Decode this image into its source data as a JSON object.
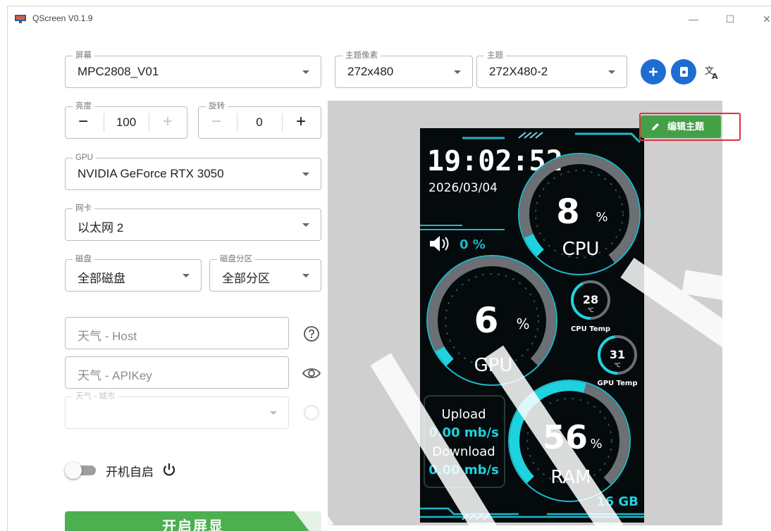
{
  "window": {
    "title": "QScreen V0.1.9",
    "controls": {
      "minimize": "—",
      "maximize": "☐",
      "close": "✕"
    }
  },
  "screen": {
    "legend": "屏幕",
    "value": "MPC2808_V01"
  },
  "theme_pixels": {
    "legend": "主题像素",
    "value": "272x480"
  },
  "theme": {
    "legend": "主题",
    "value": "272X480-2"
  },
  "actions": {
    "add_icon": "plus-icon",
    "import_icon": "document-icon",
    "translate_icon": "translate-icon"
  },
  "brightness": {
    "legend": "亮度",
    "value": "100",
    "minus": "−",
    "plus": "+"
  },
  "rotation": {
    "legend": "旋转",
    "value": "0",
    "minus": "−",
    "plus": "+"
  },
  "gpu": {
    "legend": "GPU",
    "value": "NVIDIA GeForce RTX 3050"
  },
  "nic": {
    "legend": "网卡",
    "value": "以太网 2"
  },
  "disk": {
    "legend": "磁盘",
    "value": "全部磁盘"
  },
  "partition": {
    "legend": "磁盘分区",
    "value": "全部分区"
  },
  "weather_host": {
    "placeholder": "天气 - Host"
  },
  "weather_apikey": {
    "placeholder": "天气 - APIKey"
  },
  "weather_city": {
    "legend": "天气 - 城市"
  },
  "autostart": {
    "label": "开机自启",
    "enabled": false
  },
  "start_button": {
    "label": "开启屏显"
  },
  "edit_theme": {
    "label": "编辑主题"
  },
  "device": {
    "time": "19:02:52",
    "date": "2026/03/04",
    "volume": "0 %",
    "cpu": {
      "value": "8",
      "unit": "%",
      "label": "CPU",
      "fraction": 0.08
    },
    "gpu": {
      "value": "6",
      "unit": "%",
      "label": "GPU",
      "fraction": 0.06
    },
    "ram": {
      "value": "56",
      "unit": "%",
      "label": "RAM",
      "fraction": 0.56,
      "total": "16 GB"
    },
    "cpu_temp": {
      "value": "28",
      "unit": "℃",
      "label": "CPU Temp"
    },
    "gpu_temp": {
      "value": "31",
      "unit": "℃",
      "label": "GPU Temp"
    },
    "network": {
      "upload_label": "Upload",
      "upload": "0.00 mb/s",
      "download_label": "Download",
      "download": "0.00 mb/s"
    }
  }
}
